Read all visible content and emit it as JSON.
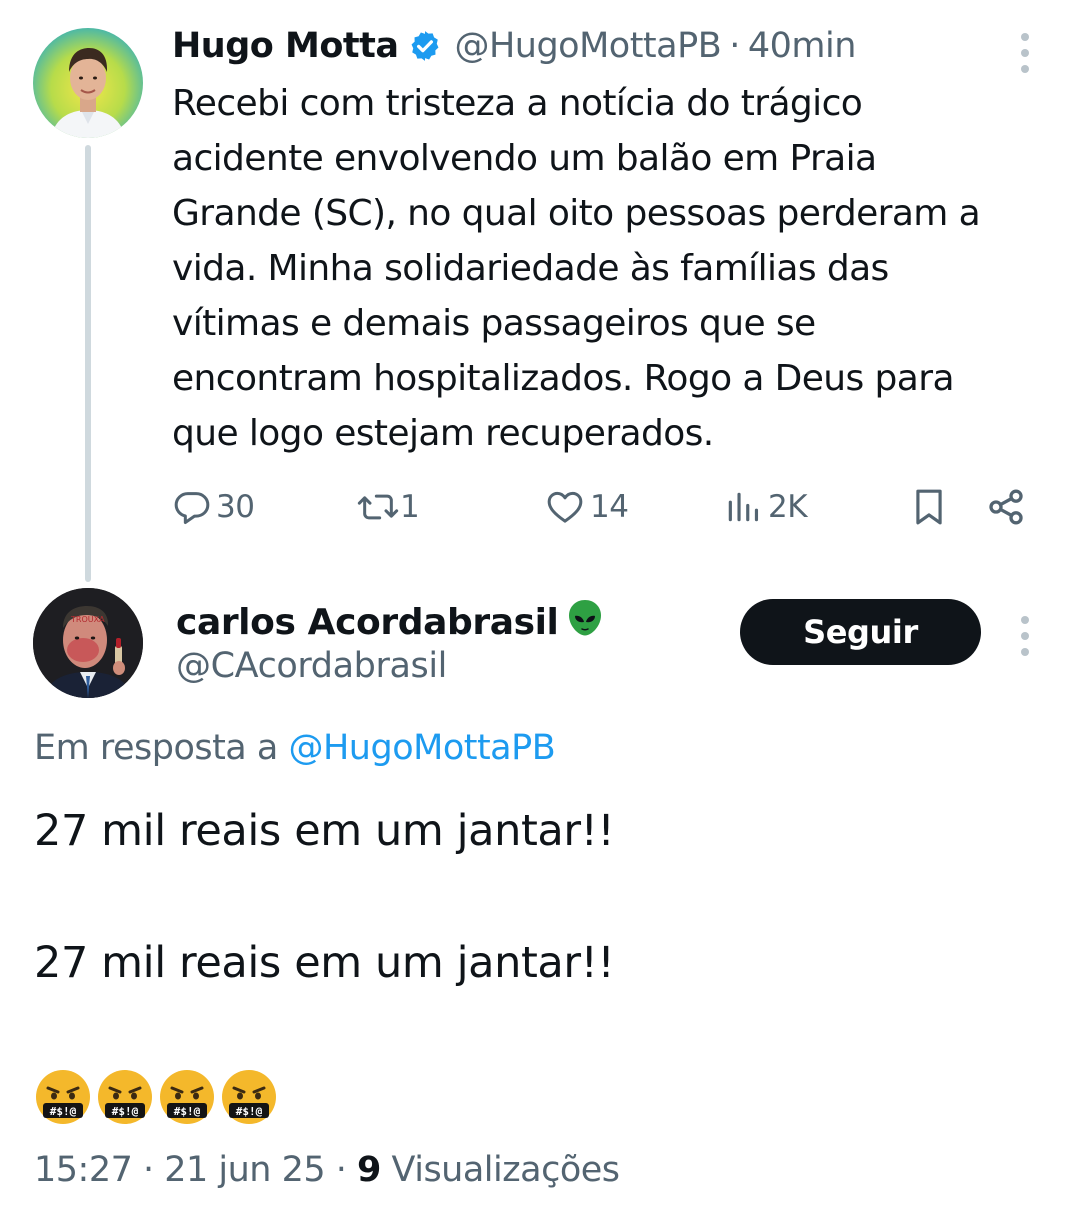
{
  "thread": {
    "original": {
      "author_name": "Hugo Motta",
      "handle": "@HugoMottaPB",
      "separator": "·",
      "time": "40min",
      "body": "Recebi com tristeza a notícia do trágico\nacidente envolvendo um balão em Praia\nGrande (SC), no qual oito pessoas perderam a\nvida. Minha solidariedade às famílias das\nvítimas e demais passageiros que se\nencontram hospitalizados. Rogo a Deus para\nque logo estejam recuperados.",
      "verified": true,
      "actions": {
        "replies": "30",
        "reposts": "1",
        "likes": "14",
        "views": "2K"
      }
    },
    "reply": {
      "author_name": "carlos Acordabrasil",
      "author_emoji": "alien-emoji",
      "handle": "@CAcordabrasil",
      "follow_label": "Seguir",
      "reply_to_prefix": "Em resposta a",
      "reply_to_handle": "@HugoMottaPB",
      "lines": [
        "27 mil reais em um jantar!!",
        "27 mil reais em um jantar!!"
      ],
      "emojis": [
        "face-with-symbols-on-mouth",
        "face-with-symbols-on-mouth",
        "face-with-symbols-on-mouth",
        "face-with-symbols-on-mouth"
      ],
      "timestamp": "15:27 · 21 jun 25 ·",
      "views_count": "9",
      "views_label": "Visualizações"
    }
  },
  "icons": {
    "reply": "speech-bubble-icon",
    "repost": "repost-icon",
    "like": "heart-icon",
    "views": "bar-chart-icon",
    "bookmark": "bookmark-icon",
    "share": "share-icon",
    "more": "vertical-ellipsis-icon"
  },
  "colors": {
    "text_primary": "#0f1419",
    "text_secondary": "#536471",
    "link": "#1d9bf0",
    "verified_badge": "#1d9bf0",
    "follow_button_bg": "#0f1419",
    "thread_line": "#cfd9de"
  }
}
